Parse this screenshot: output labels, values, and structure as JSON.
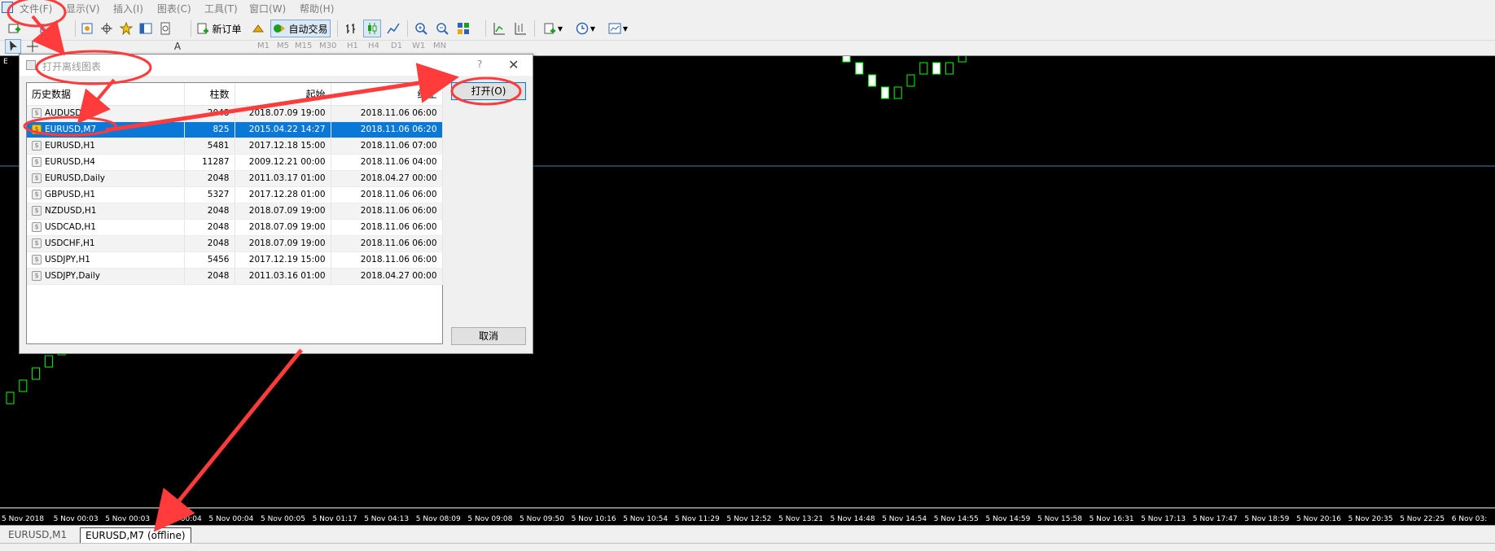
{
  "menu": [
    "文件(F)",
    "显示(V)",
    "插入(I)",
    "图表(C)",
    "工具(T)",
    "窗口(W)",
    "帮助(H)"
  ],
  "toolbar": {
    "new_order_label": "新订单",
    "auto_trading_label": "自动交易"
  },
  "timeframes": [
    "M1",
    "M5",
    "M15",
    "M30",
    "H1",
    "H4",
    "D1",
    "W1",
    "MN"
  ],
  "chart": {
    "panel_label": "E",
    "background": "#000000",
    "up_candle_color": "#00ff00",
    "down_candle_fill": "#ffffff",
    "grid_line_color": "#4a7fa8",
    "time_labels": [
      "5 Nov 2018",
      "5 Nov 00:03",
      "5 Nov 00:03",
      "5 Nov 00:04",
      "5 Nov 00:04",
      "5 Nov 00:05",
      "5 Nov 01:17",
      "5 Nov 04:13",
      "5 Nov 08:09",
      "5 Nov 09:08",
      "5 Nov 09:50",
      "5 Nov 10:16",
      "5 Nov 10:54",
      "5 Nov 11:29",
      "5 Nov 12:52",
      "5 Nov 13:21",
      "5 Nov 14:48",
      "5 Nov 14:54",
      "5 Nov 14:55",
      "5 Nov 14:59",
      "5 Nov 15:58",
      "5 Nov 16:31",
      "5 Nov 17:13",
      "5 Nov 17:47",
      "5 Nov 18:59",
      "5 Nov 20:16",
      "5 Nov 20:35",
      "5 Nov 22:25",
      "6 Nov 03:"
    ]
  },
  "tabs": [
    "EURUSD,M1",
    "EURUSD,M7 (offline)"
  ],
  "dialog": {
    "title": "打开离线图表",
    "help": "?",
    "close": "✕",
    "columns": [
      "历史数据",
      "柱数",
      "起始",
      "终止"
    ],
    "rows": [
      {
        "name": "AUDUSD,H1",
        "bars": "2048",
        "start": "2018.07.09 19:00",
        "end": "2018.11.06 06:00"
      },
      {
        "name": "EURUSD,M7",
        "bars": "825",
        "start": "2015.04.22 14:27",
        "end": "2018.11.06 06:20",
        "selected": true
      },
      {
        "name": "EURUSD,H1",
        "bars": "5481",
        "start": "2017.12.18 15:00",
        "end": "2018.11.06 07:00"
      },
      {
        "name": "EURUSD,H4",
        "bars": "11287",
        "start": "2009.12.21 00:00",
        "end": "2018.11.06 04:00"
      },
      {
        "name": "EURUSD,Daily",
        "bars": "2048",
        "start": "2011.03.17 01:00",
        "end": "2018.04.27 00:00"
      },
      {
        "name": "GBPUSD,H1",
        "bars": "5327",
        "start": "2017.12.28 01:00",
        "end": "2018.11.06 06:00"
      },
      {
        "name": "NZDUSD,H1",
        "bars": "2048",
        "start": "2018.07.09 19:00",
        "end": "2018.11.06 06:00"
      },
      {
        "name": "USDCAD,H1",
        "bars": "2048",
        "start": "2018.07.09 19:00",
        "end": "2018.11.06 06:00"
      },
      {
        "name": "USDCHF,H1",
        "bars": "2048",
        "start": "2018.07.09 19:00",
        "end": "2018.11.06 06:00"
      },
      {
        "name": "USDJPY,H1",
        "bars": "5456",
        "start": "2017.12.19 15:00",
        "end": "2018.11.06 06:00"
      },
      {
        "name": "USDJPY,Daily",
        "bars": "2048",
        "start": "2011.03.16 01:00",
        "end": "2018.04.27 00:00"
      }
    ],
    "open_button": "打开(O)",
    "cancel_button": "取消"
  },
  "annotation_color": "#ff3b3b"
}
